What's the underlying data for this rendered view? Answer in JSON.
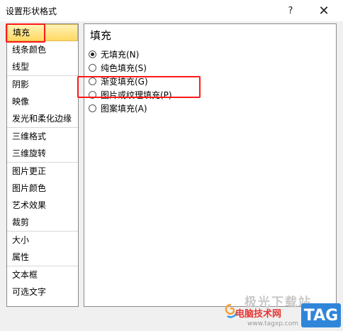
{
  "window": {
    "title": "设置形状格式",
    "help_glyph": "?",
    "close_glyph": "✕"
  },
  "sidebar": {
    "groups": [
      [
        "填充",
        "线条颜色",
        "线型"
      ],
      [
        "阴影",
        "映像",
        "发光和柔化边缘"
      ],
      [
        "三维格式",
        "三维旋转"
      ],
      [
        "图片更正",
        "图片颜色",
        "艺术效果",
        "裁剪"
      ],
      [
        "大小",
        "属性"
      ],
      [
        "文本框",
        "可选文字"
      ]
    ],
    "selected": "填充"
  },
  "panel": {
    "title": "填充",
    "options": [
      {
        "label": "无填充(N)",
        "checked": true
      },
      {
        "label": "纯色填充(S)",
        "checked": false
      },
      {
        "label": "渐变填充(G)",
        "checked": false
      },
      {
        "label": "图片或纹理填充(P)",
        "checked": false
      },
      {
        "label": "图案填充(A)",
        "checked": false
      }
    ]
  },
  "watermark": {
    "site_cn": "极光下载站",
    "site_sub": "电脑技术网",
    "url": "www.tagxp.com",
    "tag": "TAG"
  },
  "colors": {
    "highlight": "#ff1a1a",
    "selected_bg": "#ffd962",
    "watermark_blue": "#2f86d9"
  }
}
